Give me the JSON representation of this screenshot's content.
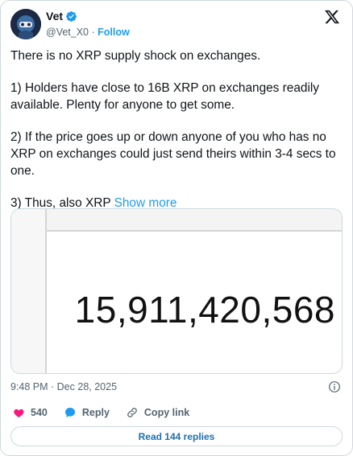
{
  "header": {
    "display_name": "Vet",
    "handle": "@Vet_X0",
    "separator": "·",
    "follow_label": "Follow"
  },
  "tweet": {
    "paragraphs": [
      "There is no XRP supply shock on exchanges.",
      "1) Holders have close to 16B XRP on exchanges readily available. Plenty for anyone to get some.",
      "2) If the price goes up or down anyone of you who has no XRP on exchanges could just send theirs within 3-4 secs to one.",
      "3) Thus, also XRP"
    ],
    "show_more_label": "Show more"
  },
  "media": {
    "number_text": "15,911,420,568"
  },
  "meta": {
    "timestamp": "9:48 PM · Dec 28, 2025"
  },
  "actions": {
    "like_count": "540",
    "reply_label": "Reply",
    "copy_link_label": "Copy link"
  },
  "read_replies_label": "Read 144 replies",
  "colors": {
    "accent": "#1d9bf0",
    "like": "#f91880",
    "verified": "#1d9bf0",
    "text_secondary": "#536471"
  },
  "icons": [
    "avatar",
    "verified-badge-icon",
    "x-logo-icon",
    "info-icon",
    "heart-icon",
    "reply-bubble-icon",
    "link-icon"
  ]
}
